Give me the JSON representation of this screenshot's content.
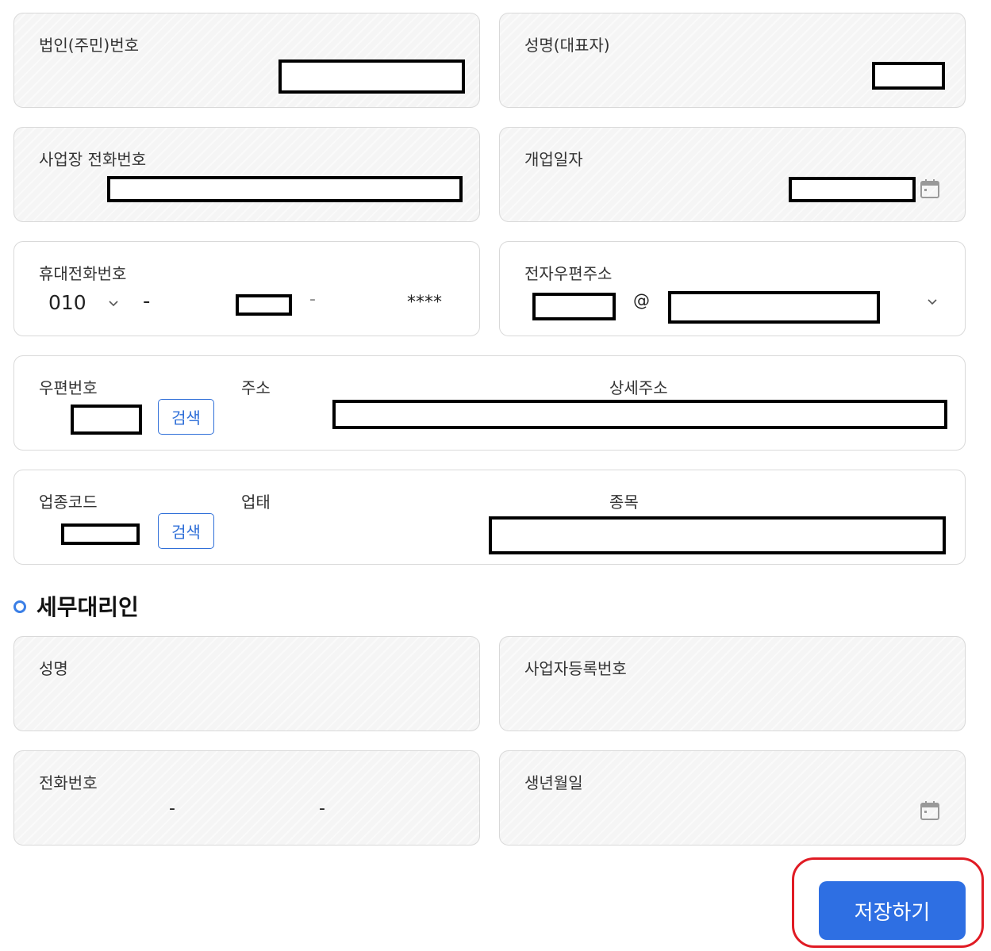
{
  "business": {
    "corp_id_label": "법인(주민)번호",
    "rep_name_label": "성명(대표자)",
    "biz_phone_label": "사업장 전화번호",
    "open_date_label": "개업일자",
    "mobile_label": "휴대전화번호",
    "mobile_prefix": "010",
    "mobile_dash_1": "-",
    "mobile_dash_2": "-",
    "mobile_last": "****",
    "email_label": "전자우편주소",
    "email_at": "@",
    "postal_label": "우편번호",
    "address_label": "주소",
    "address_detail_label": "상세주소",
    "search_label": "검색",
    "industry_code_label": "업종코드",
    "business_type_label": "업태",
    "item_label": "종목"
  },
  "tax_agent": {
    "section_title": "세무대리인",
    "name_label": "성명",
    "reg_no_label": "사업자등록번호",
    "phone_label": "전화번호",
    "phone_dash_1": "-",
    "phone_dash_2": "-",
    "birth_label": "생년월일"
  },
  "actions": {
    "save_label": "저장하기"
  },
  "colors": {
    "accent": "#2e6fe3",
    "highlight": "#e01b24",
    "readonly_bg": "#f5f5f5"
  },
  "icons": [
    "calendar-icon",
    "chevron-down-icon"
  ]
}
